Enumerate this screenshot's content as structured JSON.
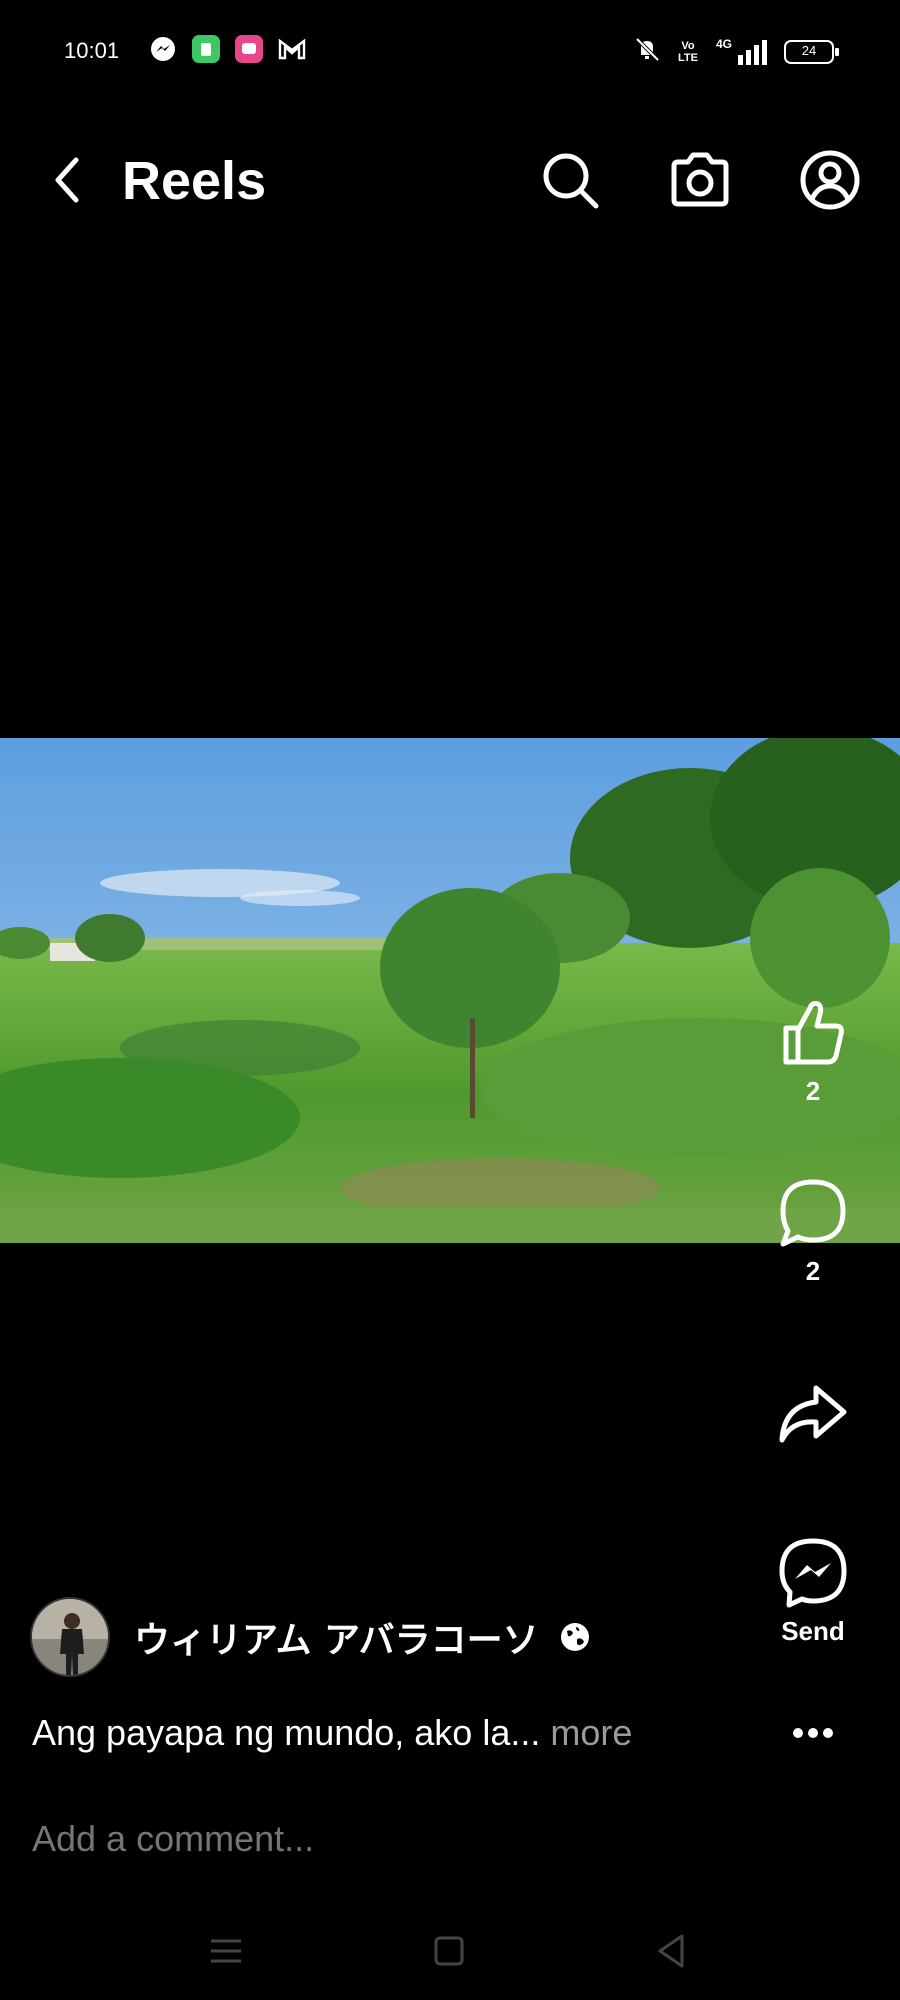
{
  "status_bar": {
    "time": "10:01",
    "notification_icons": [
      "messenger-icon",
      "green-app-icon",
      "pink-app-icon",
      "gmail-icon"
    ],
    "network_label_top": "Vo",
    "network_label_bottom": "LTE",
    "network_type": "4G",
    "battery": "24"
  },
  "header": {
    "title": "Reels",
    "icons": [
      "back-arrow-icon",
      "search-icon",
      "camera-icon",
      "profile-icon"
    ]
  },
  "actions": {
    "like_count": "2",
    "comment_count": "2",
    "send_label": "Send"
  },
  "post": {
    "author": "ウィリアム アバラコーソ",
    "caption": "Ang payapa ng mundo, ako la...",
    "more_label": "more"
  },
  "comment": {
    "placeholder": "Add a comment..."
  },
  "colors": {
    "background": "#000000",
    "text": "#ffffff",
    "muted": "#8a8a8a"
  }
}
